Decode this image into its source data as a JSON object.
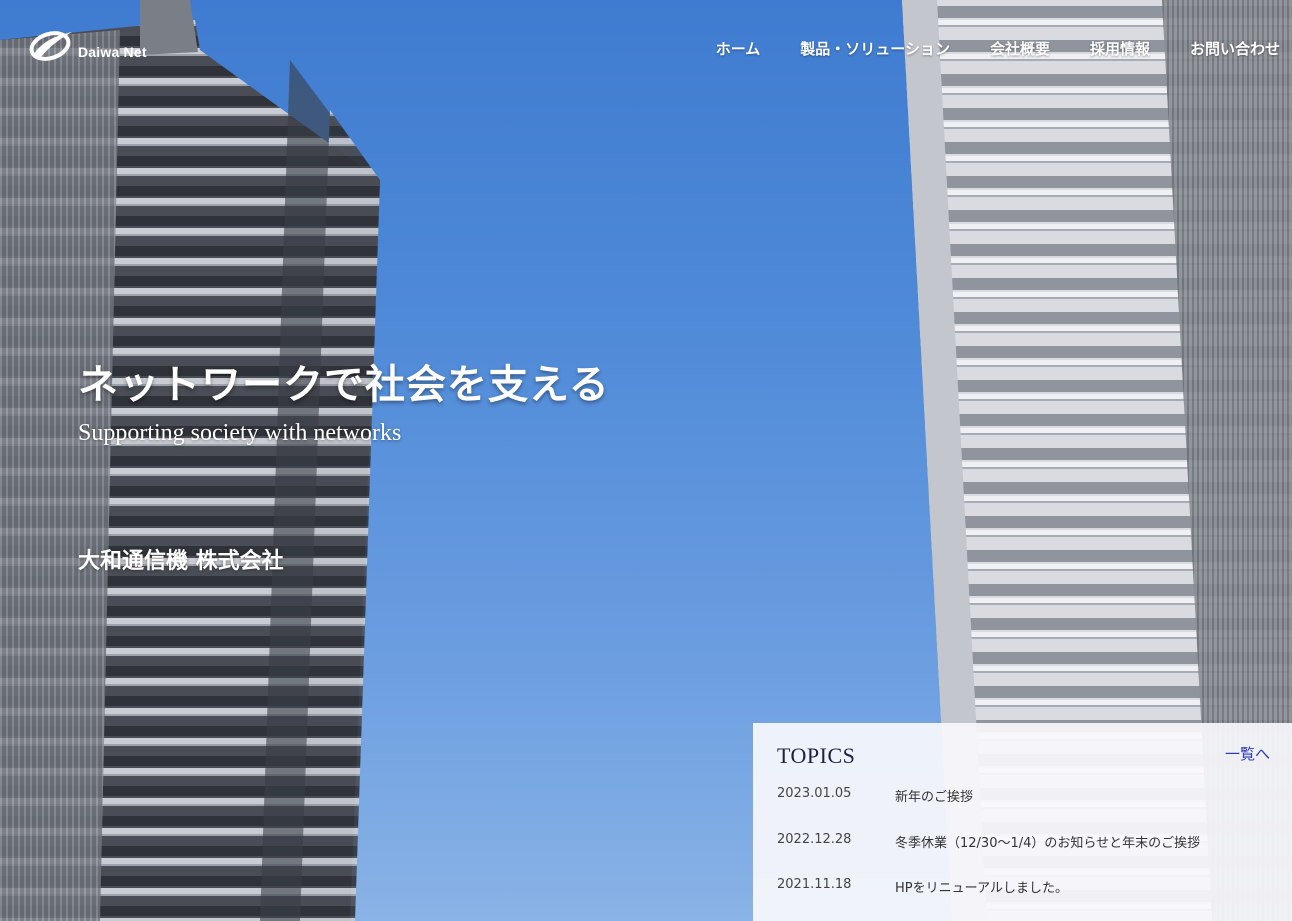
{
  "brand": {
    "logo_text": "Daiwa Net"
  },
  "nav": {
    "items": [
      {
        "label": "ホーム"
      },
      {
        "label": "製品・ソリューション"
      },
      {
        "label": "会社概要"
      },
      {
        "label": "採用情報"
      },
      {
        "label": "お問い合わせ"
      }
    ]
  },
  "hero": {
    "title": "ネットワークで社会を支える",
    "subtitle": "Supporting society with networks",
    "company": "大和通信機 株式会社"
  },
  "topics": {
    "title": "TOPICS",
    "more_label": "一覧へ",
    "items": [
      {
        "date": "2023.01.05",
        "text": "新年のご挨拶"
      },
      {
        "date": "2022.12.28",
        "text": "冬季休業（12/30～1/4）のお知らせと年末のご挨拶"
      },
      {
        "date": "2021.11.18",
        "text": "HPをリニューアルしました。"
      }
    ]
  },
  "colors": {
    "sky": "#4f8ad8",
    "topics_bg": "#f7f8fc",
    "link": "#2a3ab8",
    "white": "#ffffff"
  }
}
